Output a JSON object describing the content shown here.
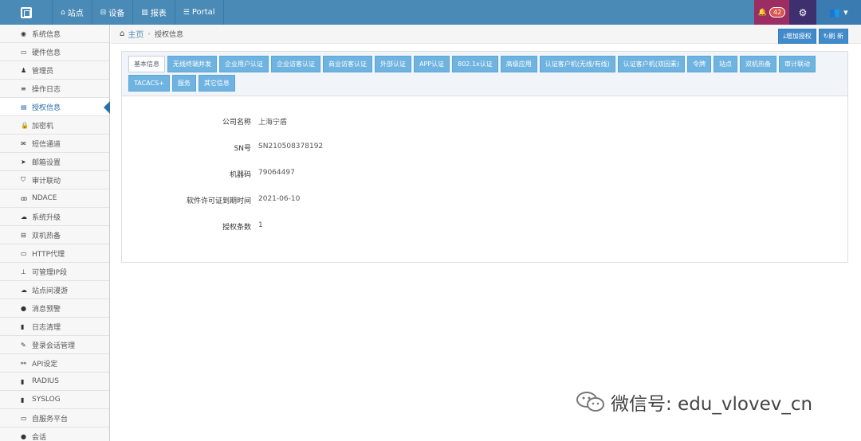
{
  "topbar": {
    "nav": [
      {
        "label": "站点",
        "icon": "router-icon"
      },
      {
        "label": "设备",
        "icon": "device-icon"
      },
      {
        "label": "报表",
        "icon": "chart-icon"
      },
      {
        "label": "Portal",
        "icon": "sliders-icon"
      }
    ],
    "notifications_count": "42"
  },
  "sidebar": {
    "items": [
      {
        "label": "系统信息",
        "icon": "dashboard-icon",
        "glyph": "◉"
      },
      {
        "label": "硬件信息",
        "icon": "laptop-icon",
        "glyph": "▭"
      },
      {
        "label": "管理员",
        "icon": "user-icon",
        "glyph": "♟"
      },
      {
        "label": "操作日志",
        "icon": "list-icon",
        "glyph": "≡"
      },
      {
        "label": "授权信息",
        "icon": "credit-card-icon",
        "glyph": "▤",
        "active": true
      },
      {
        "label": "加密机",
        "icon": "lock-icon",
        "glyph": "🔒"
      },
      {
        "label": "短信通道",
        "icon": "envelope-icon",
        "glyph": "✉"
      },
      {
        "label": "邮箱设置",
        "icon": "send-icon",
        "glyph": "➤"
      },
      {
        "label": "审计联动",
        "icon": "shield-icon",
        "glyph": "⛉"
      },
      {
        "label": "NDACE",
        "icon": "binoculars-icon",
        "glyph": "ꝏ"
      },
      {
        "label": "系统升级",
        "icon": "cloud-upload-icon",
        "glyph": "☁"
      },
      {
        "label": "双机热备",
        "icon": "hdd-icon",
        "glyph": "⊟"
      },
      {
        "label": "HTTP代理",
        "icon": "laptop-icon",
        "glyph": "▭"
      },
      {
        "label": "可管理IP段",
        "icon": "pushpin-icon",
        "glyph": "⊥"
      },
      {
        "label": "站点间漫游",
        "icon": "cloud-icon",
        "glyph": "☁"
      },
      {
        "label": "消息预警",
        "icon": "comment-icon",
        "glyph": "●"
      },
      {
        "label": "日志清理",
        "icon": "trash-icon",
        "glyph": "▮"
      },
      {
        "label": "登录会话管理",
        "icon": "wrench-icon",
        "glyph": "✎"
      },
      {
        "label": "API设定",
        "icon": "link-icon",
        "glyph": "⚯"
      },
      {
        "label": "RADIUS",
        "icon": "file-icon",
        "glyph": "▮"
      },
      {
        "label": "SYSLOG",
        "icon": "file-icon",
        "glyph": "▮"
      },
      {
        "label": "自服务平台",
        "icon": "laptop-icon",
        "glyph": "▭"
      },
      {
        "label": "会话",
        "icon": "comment-icon",
        "glyph": "●"
      }
    ]
  },
  "breadcrumb": {
    "home": "主页",
    "current": "授权信息",
    "add_license_btn": "增加授权",
    "refresh_btn": "刷 新"
  },
  "tabs": [
    {
      "label": "基本信息",
      "active": true
    },
    {
      "label": "无线终端并发"
    },
    {
      "label": "企业用户认证"
    },
    {
      "label": "企业访客认证"
    },
    {
      "label": "商业访客认证"
    },
    {
      "label": "外部认证"
    },
    {
      "label": "APP认证"
    },
    {
      "label": "802.1x认证"
    },
    {
      "label": "高级应用"
    },
    {
      "label": "认证客户机(无线/有线)"
    },
    {
      "label": "认证客户机(双因素)"
    },
    {
      "label": "令牌"
    },
    {
      "label": "站点"
    },
    {
      "label": "双机热备"
    },
    {
      "label": "审计联动"
    },
    {
      "label": "TACACS+"
    },
    {
      "label": "服务"
    },
    {
      "label": "其它信息"
    }
  ],
  "info": [
    {
      "label": "公司名称",
      "value": "上海宁盾"
    },
    {
      "label": "SN号",
      "value": "SN210508378192"
    },
    {
      "label": "机器码",
      "value": "79064497"
    },
    {
      "label": "软件许可证到期时间",
      "value": "2021-06-10"
    },
    {
      "label": "授权条数",
      "value": "1"
    }
  ],
  "watermark": {
    "text": "微信号: edu_vlovev_cn"
  },
  "colors": {
    "topbar": "#4a8ab7",
    "bell_bg": "#9b2d62",
    "gear_bg": "#3e2f6e",
    "tab_bg": "#6fb3e0",
    "button_bg": "#428bca",
    "active_link": "#2b6ea9"
  }
}
